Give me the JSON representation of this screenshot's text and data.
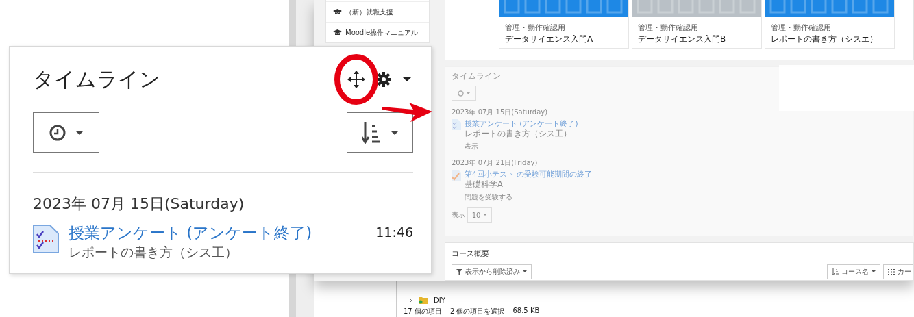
{
  "sidebar": {
    "items": [
      {
        "label": "（新）就職支援"
      },
      {
        "label": "Moodle操作マニュアル"
      }
    ]
  },
  "course_cards": [
    {
      "category": "管理・動作確認用",
      "name": "データサイエンス入門A",
      "color": "#1e88e5"
    },
    {
      "category": "管理・動作確認用",
      "name": "データサイエンス入門B",
      "color": "#b9c0c6"
    },
    {
      "category": "管理・動作確認用",
      "name": "レポートの書き方（シスエ）",
      "color": "#1e88e5"
    }
  ],
  "timeline_background": {
    "title": "タイムライン",
    "groups": [
      {
        "date": "2023年 07月 15日(Saturday)",
        "items": [
          {
            "kind": "feedback",
            "title": "授業アンケート (アンケート終了)",
            "course": "レポートの書き方（シス工）",
            "action": "表示"
          }
        ]
      },
      {
        "date": "2023年 07月 21日(Friday)",
        "items": [
          {
            "kind": "quiz",
            "title": "第4回小テスト の受験可能期間の終了",
            "course": "基礎科学A",
            "action": "問題を受験する"
          }
        ]
      }
    ],
    "show_label": "表示",
    "show_count": "10"
  },
  "course_overview": {
    "title": "コース概要",
    "filter": "表示から削除済み",
    "sort": "コース名",
    "view": "カー"
  },
  "explorer": {
    "items": [
      {
        "label": "DIY"
      }
    ],
    "status": [
      "17 個の項目",
      "2 個の項目を選択",
      "68.5 KB"
    ]
  },
  "zoom_card": {
    "title": "タイムライン",
    "date": "2023年 07月 15日(Saturday)",
    "item": {
      "kind": "feedback",
      "title": "授業アンケート (アンケート終了)",
      "course": "レポートの書き方（シス工）",
      "time": "11:46"
    }
  }
}
